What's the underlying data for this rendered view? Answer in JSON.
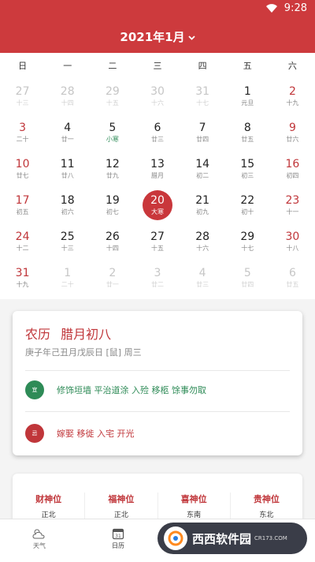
{
  "status_bar": {
    "time": "9:28"
  },
  "header": {
    "month_title": "2021年1月",
    "accent": "#cd3a3d"
  },
  "weekdays": [
    "日",
    "一",
    "二",
    "三",
    "四",
    "五",
    "六"
  ],
  "days": [
    {
      "num": "27",
      "lunar": "十三",
      "state": "dim"
    },
    {
      "num": "28",
      "lunar": "十四",
      "state": "dim"
    },
    {
      "num": "29",
      "lunar": "十五",
      "state": "dim"
    },
    {
      "num": "30",
      "lunar": "十六",
      "state": "dim"
    },
    {
      "num": "31",
      "lunar": "十七",
      "state": "dim"
    },
    {
      "num": "1",
      "lunar": "元旦",
      "state": ""
    },
    {
      "num": "2",
      "lunar": "十九",
      "state": "weekend"
    },
    {
      "num": "3",
      "lunar": "二十",
      "state": "weekend"
    },
    {
      "num": "4",
      "lunar": "廿一",
      "state": ""
    },
    {
      "num": "5",
      "lunar": "小寒",
      "state": "term"
    },
    {
      "num": "6",
      "lunar": "廿三",
      "state": ""
    },
    {
      "num": "7",
      "lunar": "廿四",
      "state": ""
    },
    {
      "num": "8",
      "lunar": "廿五",
      "state": ""
    },
    {
      "num": "9",
      "lunar": "廿六",
      "state": "weekend"
    },
    {
      "num": "10",
      "lunar": "廿七",
      "state": "weekend"
    },
    {
      "num": "11",
      "lunar": "廿八",
      "state": ""
    },
    {
      "num": "12",
      "lunar": "廿九",
      "state": ""
    },
    {
      "num": "13",
      "lunar": "腊月",
      "state": ""
    },
    {
      "num": "14",
      "lunar": "初二",
      "state": ""
    },
    {
      "num": "15",
      "lunar": "初三",
      "state": ""
    },
    {
      "num": "16",
      "lunar": "初四",
      "state": "weekend"
    },
    {
      "num": "17",
      "lunar": "初五",
      "state": "weekend"
    },
    {
      "num": "18",
      "lunar": "初六",
      "state": ""
    },
    {
      "num": "19",
      "lunar": "初七",
      "state": ""
    },
    {
      "num": "20",
      "lunar": "大寒",
      "state": "selected"
    },
    {
      "num": "21",
      "lunar": "初九",
      "state": ""
    },
    {
      "num": "22",
      "lunar": "初十",
      "state": ""
    },
    {
      "num": "23",
      "lunar": "十一",
      "state": "weekend"
    },
    {
      "num": "24",
      "lunar": "十二",
      "state": "weekend"
    },
    {
      "num": "25",
      "lunar": "十三",
      "state": ""
    },
    {
      "num": "26",
      "lunar": "十四",
      "state": ""
    },
    {
      "num": "27",
      "lunar": "十五",
      "state": ""
    },
    {
      "num": "28",
      "lunar": "十六",
      "state": ""
    },
    {
      "num": "29",
      "lunar": "十七",
      "state": ""
    },
    {
      "num": "30",
      "lunar": "十八",
      "state": "weekend"
    },
    {
      "num": "31",
      "lunar": "十九",
      "state": "weekend"
    },
    {
      "num": "1",
      "lunar": "二十",
      "state": "dim"
    },
    {
      "num": "2",
      "lunar": "廿一",
      "state": "dim"
    },
    {
      "num": "3",
      "lunar": "廿二",
      "state": "dim"
    },
    {
      "num": "4",
      "lunar": "廿三",
      "state": "dim"
    },
    {
      "num": "5",
      "lunar": "廿四",
      "state": "dim"
    },
    {
      "num": "6",
      "lunar": "廿五",
      "state": "dim"
    }
  ],
  "detail": {
    "title": "农历 腊月初八",
    "subtitle": "庚子年己丑月戊辰日 [鼠] 周三",
    "yi_badge": "宜",
    "yi_text": "修饰垣墙 平治道涂 入殓 移柩 馀事勿取",
    "yi_color": "#2e8b57",
    "ji_badge": "忌",
    "ji_text": "嫁娶 移徙 入宅 开光",
    "ji_color": "#c0363a"
  },
  "gods": [
    {
      "title": "财神位",
      "dir": "正北"
    },
    {
      "title": "福神位",
      "dir": "正北"
    },
    {
      "title": "喜神位",
      "dir": "东南"
    },
    {
      "title": "贵神位",
      "dir": "东北"
    }
  ],
  "nav": [
    {
      "label": "天气",
      "icon": "weather-icon"
    },
    {
      "label": "日历",
      "icon": "calendar-icon"
    }
  ],
  "watermark": {
    "brand": "西西软件园",
    "url": "CR173.COM"
  }
}
